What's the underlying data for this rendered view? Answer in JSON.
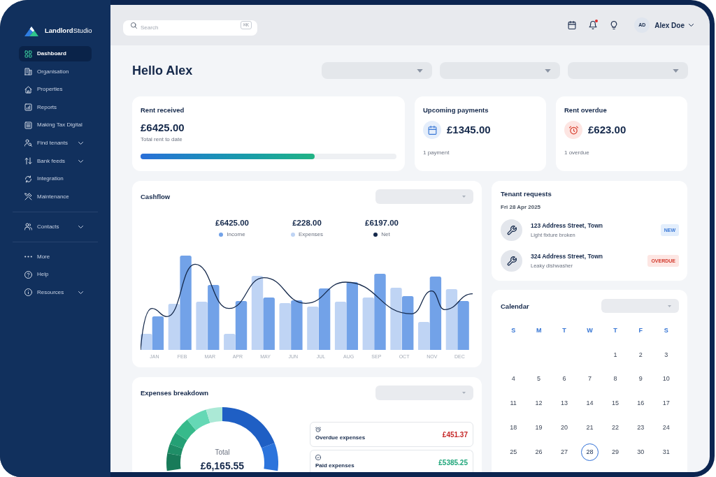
{
  "sidebar": {
    "logo": "**Landlord**Studio",
    "groups": [
      {
        "items": [
          {
            "label": "Dashboard",
            "selected": true,
            "expandable": false
          },
          {
            "label": "Organisation",
            "selected": false,
            "expandable": false
          },
          {
            "label": "Properties",
            "selected": false,
            "expandable": false
          },
          {
            "label": "Reports",
            "selected": false,
            "expandable": false
          },
          {
            "label": "Making Tax Digital",
            "selected": false,
            "expandable": false
          },
          {
            "label": "Find tenants",
            "selected": false,
            "expandable": true
          },
          {
            "label": "Bank feeds",
            "selected": false,
            "expandable": true
          },
          {
            "label": "Integration",
            "selected": false,
            "expandable": false
          },
          {
            "label": "Maintenance",
            "selected": false,
            "expandable": false
          }
        ]
      },
      {
        "items": [
          {
            "label": "Contacts",
            "selected": false,
            "expandable": true
          }
        ]
      },
      {
        "items": [
          {
            "label": "More",
            "selected": false,
            "expandable": false
          },
          {
            "label": "Help",
            "selected": false,
            "expandable": false
          },
          {
            "label": "Resources",
            "selected": false,
            "expandable": true
          }
        ]
      }
    ]
  },
  "topbar": {
    "search": {
      "placeholder": "Search",
      "shortcut": "⌘K"
    },
    "notifications": {
      "unread": true
    },
    "user": {
      "initials": "AD",
      "name": "Alex Doe"
    }
  },
  "greeting": "Hello Alex",
  "summary_cards": [
    {
      "kind": "progress",
      "title": "Rent received",
      "amount": "£6425.00",
      "caption": "Total rent to date",
      "level": 0.68
    },
    {
      "kind": "scheduled",
      "title": "Upcoming payments",
      "amount": "£1345.00",
      "caption": "1 payment"
    },
    {
      "kind": "overdue",
      "title": "Rent overdue",
      "amount": "£623.00",
      "caption": "1 overdue"
    }
  ],
  "cashflow": {
    "title": "Cashflow",
    "totals": [
      {
        "amount": "£6425.00",
        "label": "Income",
        "color": "#72a2e8"
      },
      {
        "amount": "£228.00",
        "label": "Expenses",
        "color": "#bfd4f4"
      },
      {
        "amount": "£6197.00",
        "label": "Net",
        "color": "#15294b"
      }
    ],
    "months": [
      "JAN",
      "FEB",
      "MAR",
      "APR",
      "MAY",
      "JUN",
      "JUL",
      "AUG",
      "SEP",
      "OCT",
      "NOV",
      "DEC"
    ]
  },
  "tenant_requests": {
    "title": "Tenant requests",
    "date": "Fri 28 Apr 2025",
    "items": [
      {
        "address": "123 Address Street, Town",
        "issue": "Light fixture broken",
        "status": "NEW",
        "kind": "new"
      },
      {
        "address": "324 Address Street, Town",
        "issue": "Leaky dishwasher",
        "status": "OVERDUE",
        "kind": "overdue"
      }
    ]
  },
  "expenses_breakdown": {
    "title": "Expenses breakdown",
    "total_label": "Total",
    "total": "£6,165.55",
    "items": [
      {
        "kind": "overdue",
        "label": "Overdue expenses",
        "amount": "£451.37"
      },
      {
        "kind": "paid",
        "label": "Paid expenses",
        "amount": "£5385.25"
      }
    ]
  },
  "calendar": {
    "title": "Calendar",
    "weekdays": [
      "S",
      "M",
      "T",
      "W",
      "T",
      "F",
      "S"
    ],
    "weeks": [
      [
        {
          "day": "1",
          "selected": false
        },
        {
          "day": "2",
          "selected": false
        },
        {
          "day": "3",
          "selected": false
        }
      ],
      [
        {
          "day": "4",
          "selected": false
        },
        {
          "day": "5",
          "selected": false
        },
        {
          "day": "6",
          "selected": false
        },
        {
          "day": "7",
          "selected": false
        },
        {
          "day": "8",
          "selected": false
        },
        {
          "day": "9",
          "selected": false
        },
        {
          "day": "10",
          "selected": false
        }
      ],
      [
        {
          "day": "11",
          "selected": false
        },
        {
          "day": "12",
          "selected": false
        },
        {
          "day": "13",
          "selected": false
        },
        {
          "day": "14",
          "selected": false
        },
        {
          "day": "15",
          "selected": false
        },
        {
          "day": "16",
          "selected": false
        },
        {
          "day": "17",
          "selected": false
        }
      ],
      [
        {
          "day": "18",
          "selected": false
        },
        {
          "day": "19",
          "selected": false
        },
        {
          "day": "20",
          "selected": false
        },
        {
          "day": "21",
          "selected": false
        },
        {
          "day": "22",
          "selected": false
        },
        {
          "day": "23",
          "selected": false
        },
        {
          "day": "24",
          "selected": false
        }
      ],
      [
        {
          "day": "25",
          "selected": false
        },
        {
          "day": "26",
          "selected": false
        },
        {
          "day": "27",
          "selected": false
        },
        {
          "day": "28",
          "selected": true
        },
        {
          "day": "29",
          "selected": false
        },
        {
          "day": "30",
          "selected": false
        },
        {
          "day": "31",
          "selected": false
        }
      ]
    ]
  }
}
